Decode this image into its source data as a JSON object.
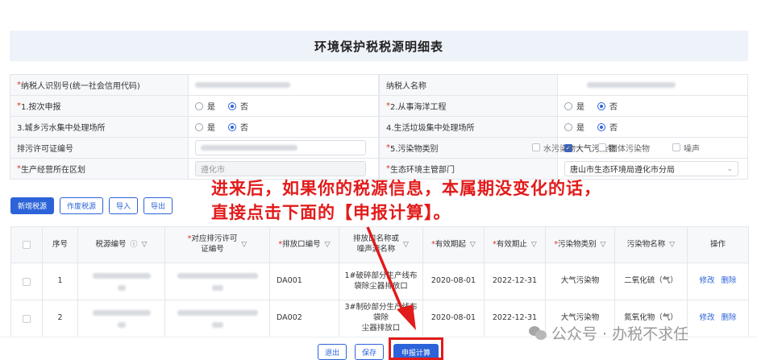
{
  "title": "环境保护税税源明细表",
  "form": {
    "taxpayer_id_label": "*纳税人识别号(统一社会信用代码)",
    "taxpayer_name_label": "纳税人名称",
    "by_time_label": "*1.按次申报",
    "marine_label": "*2.从事海洋工程",
    "sewage_label": "3.城乡污水集中处理场所",
    "waste_label": "4.生活垃圾集中处理场所",
    "permit_label": "排污许可证编号",
    "pollutant_type_label": "*5.污染物类别",
    "region_label": "*生产经营所在区划",
    "region_value": "遵化市",
    "env_dept_label": "*生态环境主管部门",
    "env_dept_value": "唐山市生态环境局遵化市分局",
    "yes": "是",
    "no": "否",
    "pollutant_options": [
      "大气污染物",
      "水污染物",
      "固体污染物",
      "噪声"
    ]
  },
  "toolbar": {
    "add": "新增税源",
    "void": "作废税源",
    "import": "导入",
    "export": "导出"
  },
  "annotation": {
    "line1": "进来后，如果你的税源信息，本属期没变化的话，",
    "line2": "直接点击下面的【申报计算】。"
  },
  "table": {
    "headers": {
      "seq": "序号",
      "source_no": "税源编号",
      "permit_no_1": "*对应排污许可",
      "permit_no_2": "证编号",
      "outlet_no": "*排放口编号",
      "outlet_name_1": "排放口名称或",
      "outlet_name_2": "噪声源名称",
      "start": "*有效期起",
      "end": "*有效期止",
      "ptype": "*污染物类别",
      "pname": "污染物名称",
      "ops": "操作"
    },
    "rows": [
      {
        "seq": "1",
        "outlet_no": "DA001",
        "outlet_name_1": "1#破碎部分生产线布",
        "outlet_name_2": "袋除尘器排放口",
        "start": "2020-08-01",
        "end": "2022-12-31",
        "ptype": "大气污染物",
        "pname": "二氧化硫（气）",
        "edit": "修改",
        "delete": "删除"
      },
      {
        "seq": "2",
        "outlet_no": "DA002",
        "outlet_name_1": "3#制砂部分生产线布袋除",
        "outlet_name_2": "尘器排放口",
        "start": "2020-08-01",
        "end": "2022-12-31",
        "ptype": "大气污染物",
        "pname": "氮氧化物（气）",
        "edit": "修改",
        "delete": "删除"
      }
    ]
  },
  "bottom": {
    "exit": "退出",
    "save": "保存",
    "calc": "申报计算"
  },
  "watermark": "公众号 · 办税不求任",
  "colors": {
    "primary": "#2d63d8",
    "annotation": "#e21b1b"
  }
}
